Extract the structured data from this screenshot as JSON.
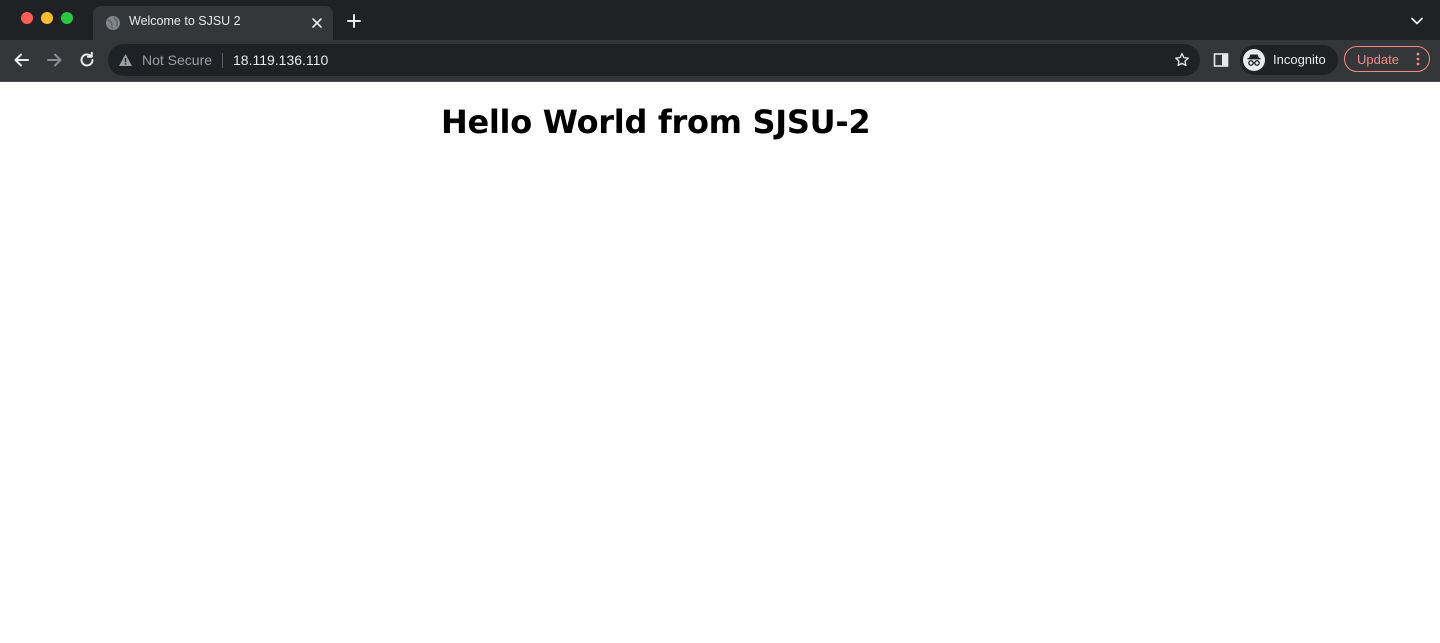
{
  "window": {
    "traffic_lights": [
      "close",
      "minimize",
      "maximize"
    ]
  },
  "tabs": [
    {
      "title": "Welcome to SJSU 2",
      "favicon": "globe-icon",
      "active": true
    }
  ],
  "tabstrip": {
    "new_tab_icon": "plus-icon",
    "tab_search_icon": "chevron-down-icon"
  },
  "toolbar": {
    "back_icon": "arrow-left-icon",
    "forward_icon": "arrow-right-icon",
    "reload_icon": "reload-icon",
    "security_label": "Not Secure",
    "security_icon": "warning-icon",
    "url": "18.119.136.110",
    "bookmark_icon": "star-icon",
    "side_panel_icon": "side-panel-icon",
    "profile_label": "Incognito",
    "profile_icon": "incognito-icon",
    "update_label": "Update",
    "menu_icon": "more-vertical-icon"
  },
  "page": {
    "heading": "Hello World from SJSU-2"
  },
  "colors": {
    "tabstrip_bg": "#202124",
    "toolbar_bg": "#35363a",
    "omnibox_bg": "#202124",
    "update_accent": "#f28b82",
    "page_bg": "#ffffff"
  }
}
